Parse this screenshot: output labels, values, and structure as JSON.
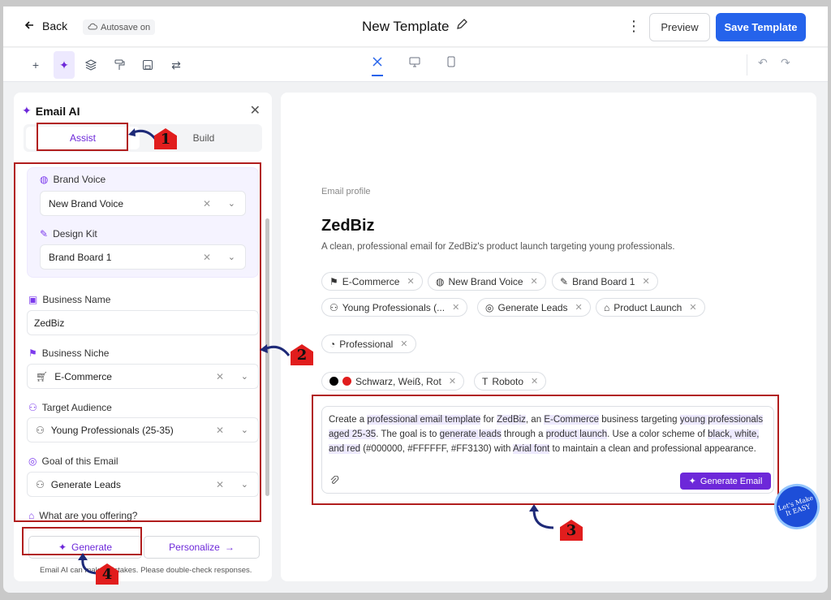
{
  "header": {
    "back_label": "Back",
    "autosave": "Autosave on",
    "title": "New Template",
    "preview_label": "Preview",
    "save_label": "Save Template"
  },
  "panel": {
    "title": "Email AI",
    "tabs": [
      "Assist",
      "Build"
    ],
    "brand_voice": {
      "label": "Brand Voice",
      "value": "New Brand Voice"
    },
    "design_kit": {
      "label": "Design Kit",
      "value": "Brand Board 1"
    },
    "business_name": {
      "label": "Business Name",
      "value": "ZedBiz"
    },
    "business_niche": {
      "label": "Business Niche",
      "value": "E-Commerce"
    },
    "target_audience": {
      "label": "Target Audience",
      "value": "Young Professionals (25-35)"
    },
    "goal": {
      "label": "Goal of this Email",
      "value": "Generate Leads"
    },
    "offering": {
      "label": "What are you offering?"
    },
    "generate_label": "Generate",
    "personalize_label": "Personalize",
    "disclaimer": "Email AI can make mistakes. Please double-check responses."
  },
  "canvas": {
    "profile_label": "Email profile",
    "brand": "ZedBiz",
    "subtitle": "A clean, professional email for ZedBiz's product launch targeting young professionals.",
    "chips_row1": [
      "E-Commerce",
      "New Brand Voice",
      "Brand Board 1"
    ],
    "chips_row2": [
      "Young Professionals (...",
      "Generate Leads",
      "Product Launch"
    ],
    "chips_row3": [
      "Professional"
    ],
    "colors_chip": "Schwarz, Weiß, Rot",
    "font_chip": "Roboto",
    "prompt": {
      "p1": "Create a ",
      "h1": "professional email template",
      "p2": " for ",
      "h2": "ZedBiz",
      "p3": ", an ",
      "h3": "E-Commerce",
      "p4": " business targeting ",
      "h4": "young professionals aged 25-35",
      "p5": ". The goal is to ",
      "h5": "generate leads",
      "p6": " through a ",
      "h6": "product launch",
      "p7": ". Use a color scheme of ",
      "h7": "black, white, and red",
      "p8": " (#000000, #FFFFFF, #FF3130) with ",
      "h8": "Arial font",
      "p9": " to maintain a clean and professional appearance."
    },
    "generate_email_label": "Generate Email"
  },
  "annotations": [
    "1",
    "2",
    "3",
    "4"
  ],
  "watermark": "Let's Make It EASY",
  "colors": {
    "accent": "#6d28d9",
    "primary": "#2563eb",
    "annotation": "#b11d1d",
    "swatch_black": "#000000",
    "swatch_red": "#e11d1d"
  }
}
